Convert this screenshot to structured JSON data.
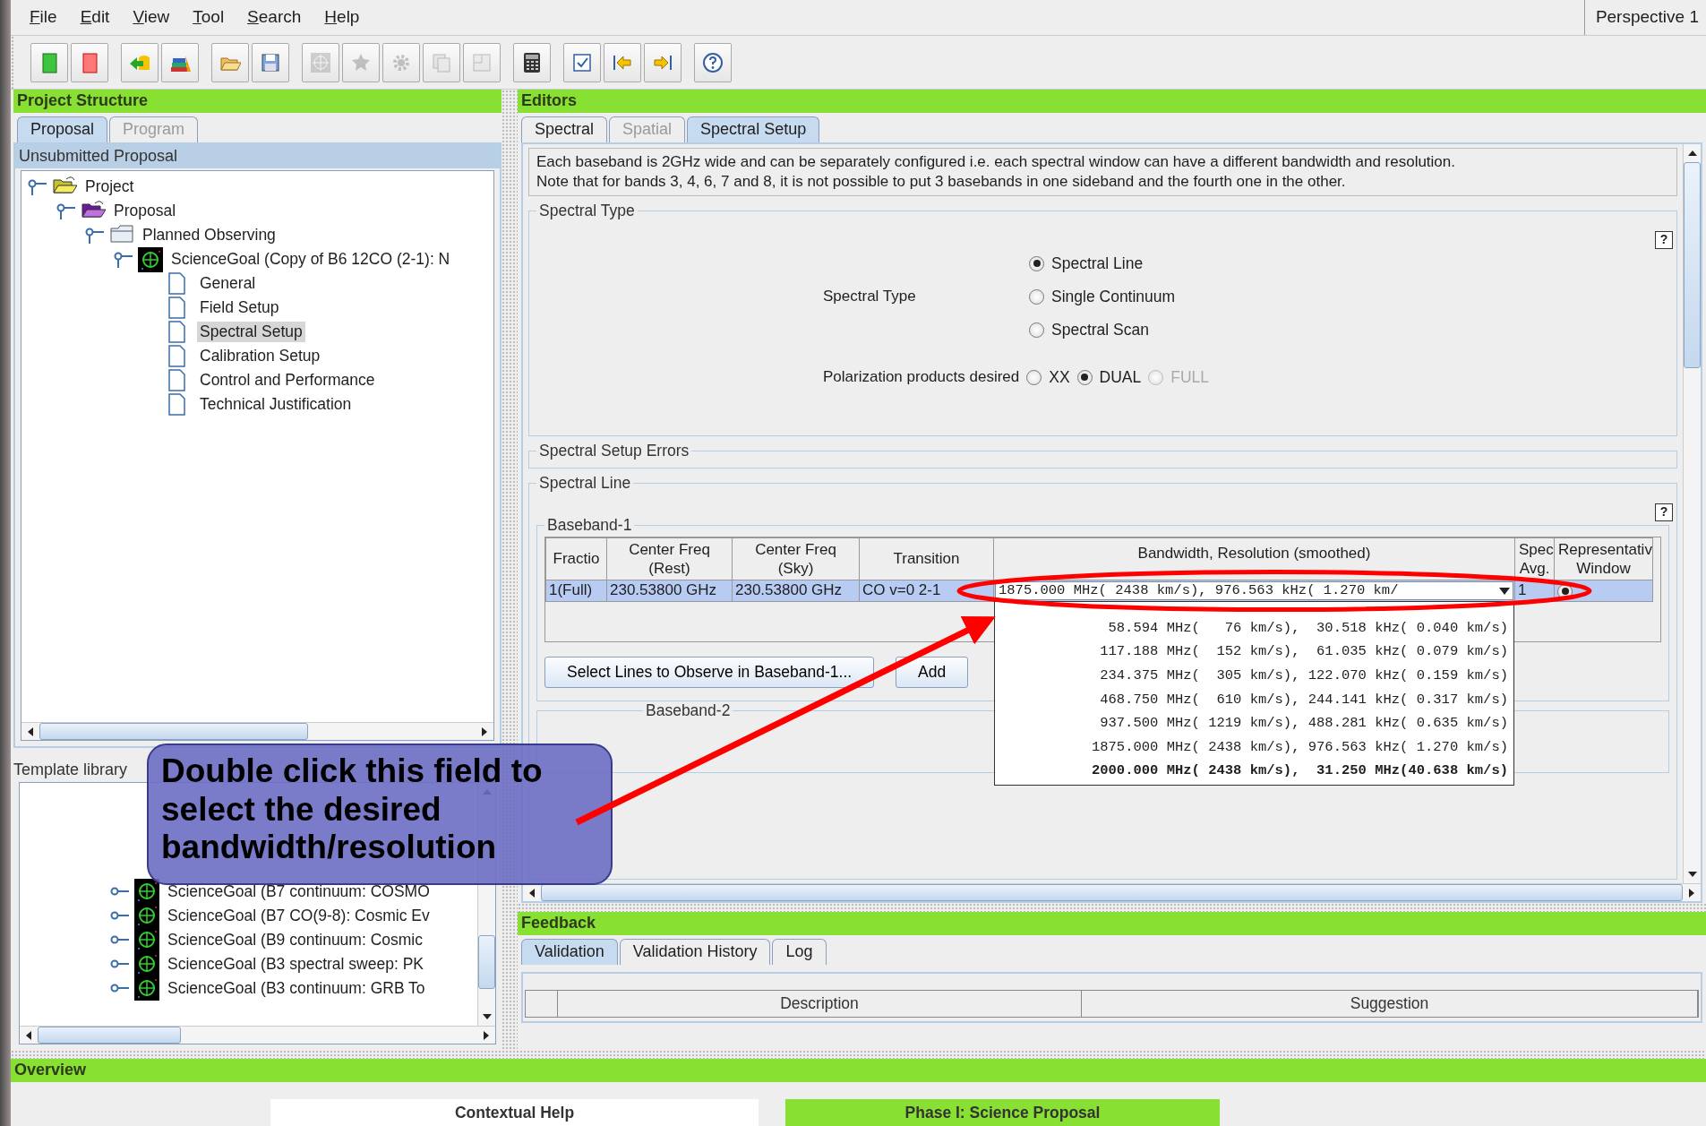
{
  "menu": [
    {
      "label": "File"
    },
    {
      "label": "Edit"
    },
    {
      "label": "View"
    },
    {
      "label": "Tool"
    },
    {
      "label": "Search"
    },
    {
      "label": "Help"
    }
  ],
  "perspective": "Perspective 1",
  "toolbar": [
    [
      {
        "kind": "new-green",
        "disabled": false
      },
      {
        "kind": "new-red",
        "disabled": false
      }
    ],
    [
      {
        "kind": "import",
        "disabled": false
      },
      {
        "kind": "books",
        "disabled": false
      }
    ],
    [
      {
        "kind": "open",
        "disabled": false
      },
      {
        "kind": "save",
        "disabled": false
      }
    ],
    [
      {
        "kind": "target",
        "disabled": true
      },
      {
        "kind": "star",
        "disabled": true
      },
      {
        "kind": "gear",
        "disabled": true
      },
      {
        "kind": "copy",
        "disabled": true
      },
      {
        "kind": "panel",
        "disabled": true
      }
    ],
    [
      {
        "kind": "calculator",
        "disabled": false
      }
    ],
    [
      {
        "kind": "check",
        "disabled": false
      },
      {
        "kind": "back",
        "disabled": false
      },
      {
        "kind": "forward",
        "disabled": false
      }
    ],
    [
      {
        "kind": "help",
        "disabled": false
      }
    ]
  ],
  "project_structure": {
    "title": "Project Structure",
    "tabs": [
      {
        "label": "Proposal",
        "selected": true,
        "disabled": false
      },
      {
        "label": "Program",
        "selected": false,
        "disabled": true
      }
    ],
    "panel_title": "Unsubmitted Proposal",
    "tree": [
      {
        "label": "Project",
        "kind": "project",
        "expanded": true,
        "selected": false,
        "children": [
          {
            "label": "Proposal",
            "kind": "proposal",
            "expanded": true,
            "selected": false,
            "children": [
              {
                "label": "Planned Observing",
                "kind": "group",
                "expanded": true,
                "selected": false,
                "children": [
                  {
                    "label": "ScienceGoal (Copy of B6 12CO (2-1): N",
                    "kind": "goal",
                    "expanded": true,
                    "selected": false,
                    "children": [
                      {
                        "label": "General",
                        "kind": "page",
                        "selected": false
                      },
                      {
                        "label": "Field Setup",
                        "kind": "page",
                        "selected": false
                      },
                      {
                        "label": "Spectral Setup",
                        "kind": "page",
                        "selected": true
                      },
                      {
                        "label": "Calibration Setup",
                        "kind": "page",
                        "selected": false
                      },
                      {
                        "label": "Control and Performance",
                        "kind": "page",
                        "selected": false
                      },
                      {
                        "label": "Technical Justification",
                        "kind": "page",
                        "selected": false
                      }
                    ]
                  }
                ]
              }
            ]
          }
        ]
      }
    ]
  },
  "template_library": {
    "title": "Template library",
    "tree": [
      {
        "label": "ScienceGoal (B7 continuum: COSMO",
        "kind": "goal",
        "expanded": false,
        "selected": false
      },
      {
        "label": "ScienceGoal (B7 CO(9-8): Cosmic Ev",
        "kind": "goal",
        "expanded": false,
        "selected": false
      },
      {
        "label": "ScienceGoal (B9 continuum: Cosmic",
        "kind": "goal",
        "expanded": false,
        "selected": false
      },
      {
        "label": "ScienceGoal (B3 spectral sweep: PK",
        "kind": "goal",
        "expanded": false,
        "selected": false
      },
      {
        "label": "ScienceGoal (B3 continuum: GRB To",
        "kind": "goal",
        "expanded": false,
        "selected": false
      }
    ]
  },
  "editors": {
    "title": "Editors",
    "tabs": [
      {
        "label": "Spectral",
        "selected": false,
        "disabled": false
      },
      {
        "label": "Spatial",
        "selected": false,
        "disabled": true
      },
      {
        "label": "Spectral Setup",
        "selected": true,
        "disabled": false
      }
    ],
    "info_lines": [
      "Each baseband is 2GHz wide and can be separately configured i.e. each spectral window can have a different bandwidth and resolution.",
      "Note that for bands 3, 4, 6, 7 and 8, it is not possible to put 3 basebands in one sideband and the fourth one in the other."
    ],
    "spectral_type_section": {
      "title": "Spectral Type",
      "help": "?",
      "label": "Spectral Type",
      "options": [
        {
          "label": "Spectral Line",
          "selected": true
        },
        {
          "label": "Single Continuum",
          "selected": false
        },
        {
          "label": "Spectral Scan",
          "selected": false
        }
      ],
      "polarization": {
        "label": "Polarization products desired",
        "options": [
          {
            "label": "XX",
            "selected": false,
            "disabled": false
          },
          {
            "label": "DUAL",
            "selected": true,
            "disabled": false
          },
          {
            "label": "FULL",
            "selected": false,
            "disabled": true
          }
        ]
      }
    },
    "errors_section": {
      "title": "Spectral Setup Errors"
    },
    "spectral_line_section": {
      "title": "Spectral Line",
      "help": "?",
      "baseband": {
        "title": "Baseband-1",
        "columns": [
          "Fractio",
          "Center Freq (Rest)",
          "Center Freq (Sky)",
          "Transition",
          "Bandwidth, Resolution (smoothed)",
          "Spec Avg.",
          "Representativ Window"
        ],
        "rows": [
          {
            "selected": true,
            "fraction": "1(Full)",
            "rest": "230.53800 GHz",
            "sky": "230.53800 GHz",
            "transition": "CO v=0 2-1",
            "bandwidth": "1875.000 MHz( 2438 km/s), 976.563 kHz( 1.270 km/",
            "spec_avg": "1",
            "representative": true
          }
        ],
        "dropdown_options": [
          {
            "label": "58.594 MHz(   76 km/s),  30.518 kHz( 0.040 km/s)",
            "emphasized": false
          },
          {
            "label": "117.188 MHz(  152 km/s),  61.035 kHz( 0.079 km/s)",
            "emphasized": false
          },
          {
            "label": "234.375 MHz(  305 km/s), 122.070 kHz( 0.159 km/s)",
            "emphasized": false
          },
          {
            "label": "468.750 MHz(  610 km/s), 244.141 kHz( 0.317 km/s)",
            "emphasized": false
          },
          {
            "label": "937.500 MHz( 1219 km/s), 488.281 kHz( 0.635 km/s)",
            "emphasized": false
          },
          {
            "label": "1875.000 MHz( 2438 km/s), 976.563 kHz( 1.270 km/s)",
            "emphasized": false
          },
          {
            "label": "2000.000 MHz( 2438 km/s),  31.250 MHz(40.638 km/s)",
            "emphasized": true
          }
        ],
        "buttons": [
          "Select Lines to Observe in Baseband-1...",
          "Add"
        ]
      },
      "baseband_2": {
        "title": "Baseband-2"
      }
    }
  },
  "feedback": {
    "title": "Feedback",
    "tabs": [
      {
        "label": "Validation",
        "selected": true
      },
      {
        "label": "Validation History",
        "selected": false
      },
      {
        "label": "Log",
        "selected": false
      }
    ],
    "columns": [
      "Description",
      "Suggestion"
    ]
  },
  "overview": {
    "title": "Overview",
    "items": [
      {
        "kind": "plain",
        "label": "Contextual Help"
      },
      {
        "kind": "highlight",
        "label": "Phase I: Science Proposal"
      }
    ]
  },
  "callout": {
    "text": "Double click this field to select the desired bandwidth/resolution"
  }
}
